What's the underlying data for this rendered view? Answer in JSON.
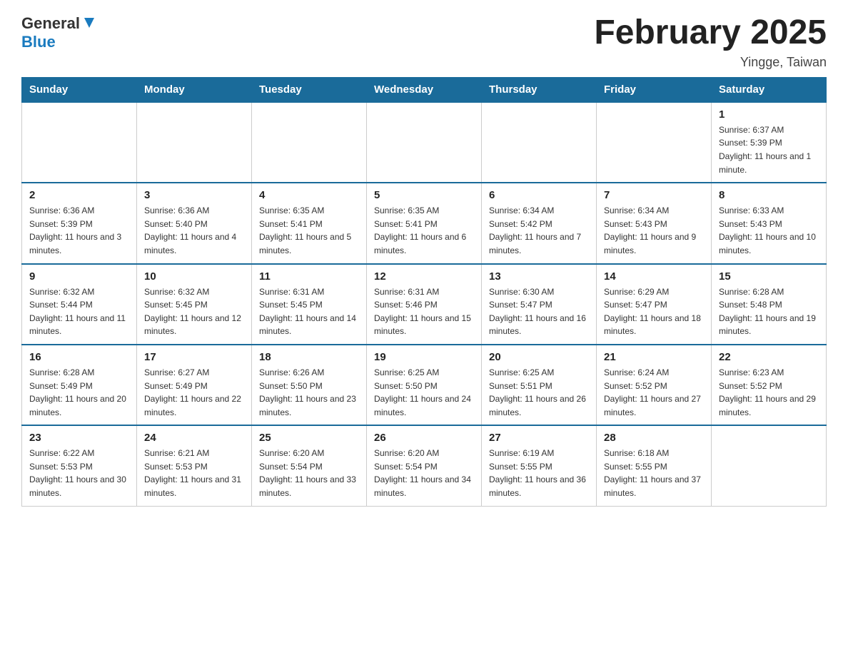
{
  "header": {
    "logo": {
      "general": "General",
      "blue": "Blue"
    },
    "title": "February 2025",
    "location": "Yingge, Taiwan"
  },
  "calendar": {
    "days_of_week": [
      "Sunday",
      "Monday",
      "Tuesday",
      "Wednesday",
      "Thursday",
      "Friday",
      "Saturday"
    ],
    "weeks": [
      [
        {
          "day": "",
          "info": ""
        },
        {
          "day": "",
          "info": ""
        },
        {
          "day": "",
          "info": ""
        },
        {
          "day": "",
          "info": ""
        },
        {
          "day": "",
          "info": ""
        },
        {
          "day": "",
          "info": ""
        },
        {
          "day": "1",
          "info": "Sunrise: 6:37 AM\nSunset: 5:39 PM\nDaylight: 11 hours and 1 minute."
        }
      ],
      [
        {
          "day": "2",
          "info": "Sunrise: 6:36 AM\nSunset: 5:39 PM\nDaylight: 11 hours and 3 minutes."
        },
        {
          "day": "3",
          "info": "Sunrise: 6:36 AM\nSunset: 5:40 PM\nDaylight: 11 hours and 4 minutes."
        },
        {
          "day": "4",
          "info": "Sunrise: 6:35 AM\nSunset: 5:41 PM\nDaylight: 11 hours and 5 minutes."
        },
        {
          "day": "5",
          "info": "Sunrise: 6:35 AM\nSunset: 5:41 PM\nDaylight: 11 hours and 6 minutes."
        },
        {
          "day": "6",
          "info": "Sunrise: 6:34 AM\nSunset: 5:42 PM\nDaylight: 11 hours and 7 minutes."
        },
        {
          "day": "7",
          "info": "Sunrise: 6:34 AM\nSunset: 5:43 PM\nDaylight: 11 hours and 9 minutes."
        },
        {
          "day": "8",
          "info": "Sunrise: 6:33 AM\nSunset: 5:43 PM\nDaylight: 11 hours and 10 minutes."
        }
      ],
      [
        {
          "day": "9",
          "info": "Sunrise: 6:32 AM\nSunset: 5:44 PM\nDaylight: 11 hours and 11 minutes."
        },
        {
          "day": "10",
          "info": "Sunrise: 6:32 AM\nSunset: 5:45 PM\nDaylight: 11 hours and 12 minutes."
        },
        {
          "day": "11",
          "info": "Sunrise: 6:31 AM\nSunset: 5:45 PM\nDaylight: 11 hours and 14 minutes."
        },
        {
          "day": "12",
          "info": "Sunrise: 6:31 AM\nSunset: 5:46 PM\nDaylight: 11 hours and 15 minutes."
        },
        {
          "day": "13",
          "info": "Sunrise: 6:30 AM\nSunset: 5:47 PM\nDaylight: 11 hours and 16 minutes."
        },
        {
          "day": "14",
          "info": "Sunrise: 6:29 AM\nSunset: 5:47 PM\nDaylight: 11 hours and 18 minutes."
        },
        {
          "day": "15",
          "info": "Sunrise: 6:28 AM\nSunset: 5:48 PM\nDaylight: 11 hours and 19 minutes."
        }
      ],
      [
        {
          "day": "16",
          "info": "Sunrise: 6:28 AM\nSunset: 5:49 PM\nDaylight: 11 hours and 20 minutes."
        },
        {
          "day": "17",
          "info": "Sunrise: 6:27 AM\nSunset: 5:49 PM\nDaylight: 11 hours and 22 minutes."
        },
        {
          "day": "18",
          "info": "Sunrise: 6:26 AM\nSunset: 5:50 PM\nDaylight: 11 hours and 23 minutes."
        },
        {
          "day": "19",
          "info": "Sunrise: 6:25 AM\nSunset: 5:50 PM\nDaylight: 11 hours and 24 minutes."
        },
        {
          "day": "20",
          "info": "Sunrise: 6:25 AM\nSunset: 5:51 PM\nDaylight: 11 hours and 26 minutes."
        },
        {
          "day": "21",
          "info": "Sunrise: 6:24 AM\nSunset: 5:52 PM\nDaylight: 11 hours and 27 minutes."
        },
        {
          "day": "22",
          "info": "Sunrise: 6:23 AM\nSunset: 5:52 PM\nDaylight: 11 hours and 29 minutes."
        }
      ],
      [
        {
          "day": "23",
          "info": "Sunrise: 6:22 AM\nSunset: 5:53 PM\nDaylight: 11 hours and 30 minutes."
        },
        {
          "day": "24",
          "info": "Sunrise: 6:21 AM\nSunset: 5:53 PM\nDaylight: 11 hours and 31 minutes."
        },
        {
          "day": "25",
          "info": "Sunrise: 6:20 AM\nSunset: 5:54 PM\nDaylight: 11 hours and 33 minutes."
        },
        {
          "day": "26",
          "info": "Sunrise: 6:20 AM\nSunset: 5:54 PM\nDaylight: 11 hours and 34 minutes."
        },
        {
          "day": "27",
          "info": "Sunrise: 6:19 AM\nSunset: 5:55 PM\nDaylight: 11 hours and 36 minutes."
        },
        {
          "day": "28",
          "info": "Sunrise: 6:18 AM\nSunset: 5:55 PM\nDaylight: 11 hours and 37 minutes."
        },
        {
          "day": "",
          "info": ""
        }
      ]
    ]
  }
}
